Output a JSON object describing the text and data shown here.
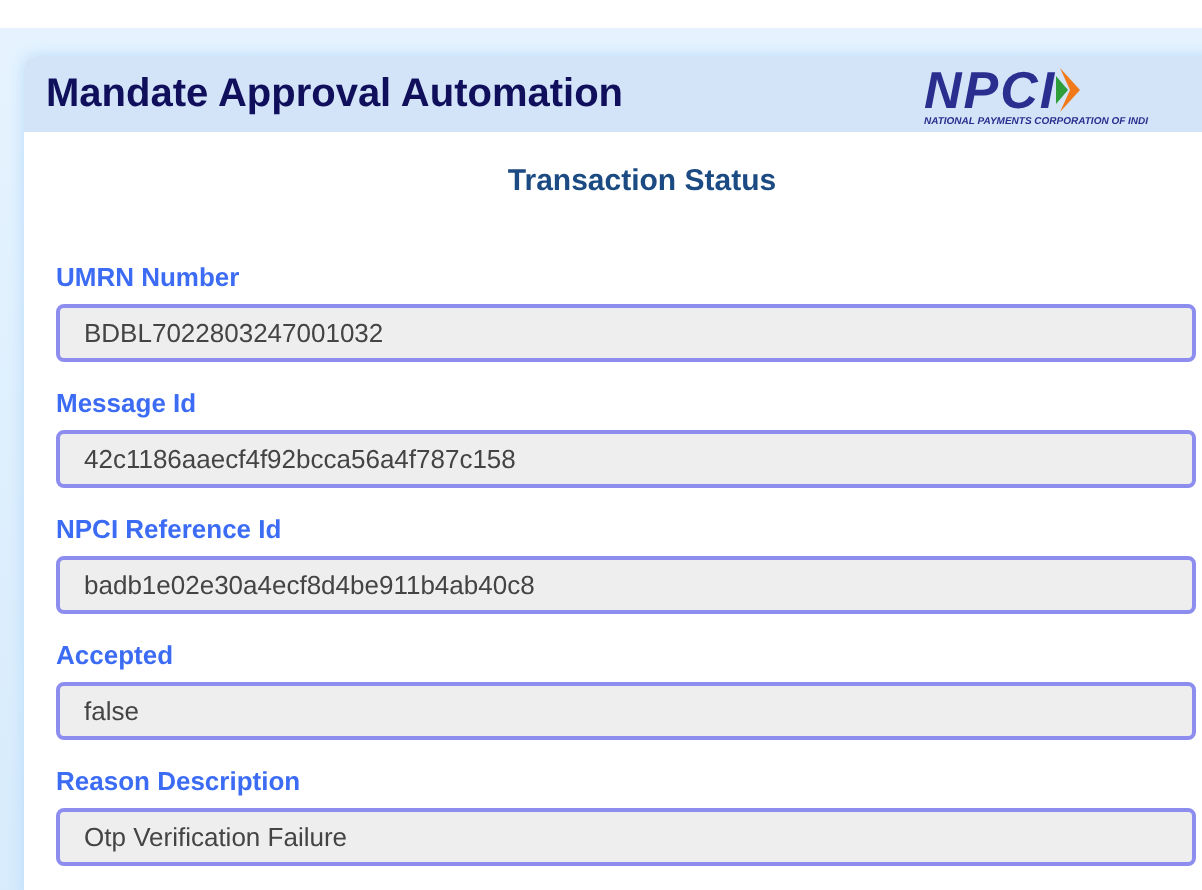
{
  "header": {
    "title": "Mandate Approval Automation",
    "logo": {
      "wordmark": "NPCI",
      "tagline": "NATIONAL PAYMENTS CORPORATION OF INDI"
    }
  },
  "heading": "Transaction Status",
  "fields": [
    {
      "label": "UMRN Number",
      "value": "BDBL7022803247001032"
    },
    {
      "label": "Message Id",
      "value": "42c1186aaecf4f92bcca56a4f787c158"
    },
    {
      "label": "NPCI Reference Id",
      "value": "badb1e02e30a4ecf8d4be911b4ab40c8"
    },
    {
      "label": "Accepted",
      "value": "false"
    },
    {
      "label": "Reason Description",
      "value": "Otp Verification Failure"
    }
  ]
}
